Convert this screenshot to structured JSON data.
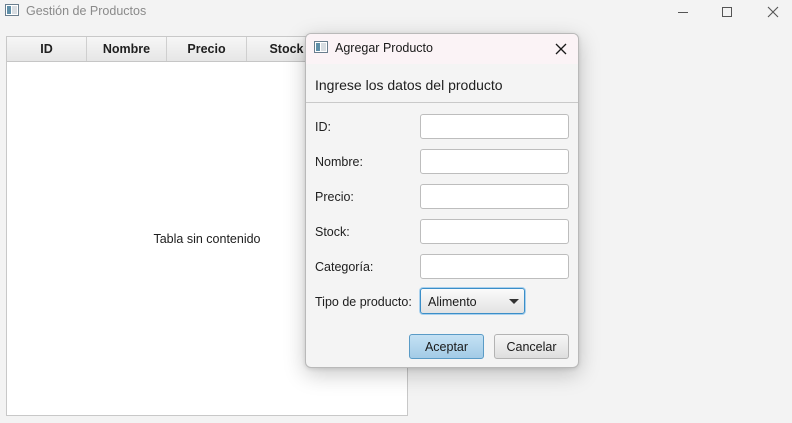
{
  "window": {
    "title": "Gestión de Productos"
  },
  "table": {
    "columns": [
      "ID",
      "Nombre",
      "Precio",
      "Stock"
    ],
    "placeholder": "Tabla sin contenido"
  },
  "dialog": {
    "title": "Agregar Producto",
    "header": "Ingrese los datos del producto",
    "fields": [
      {
        "label": "ID:",
        "value": ""
      },
      {
        "label": "Nombre:",
        "value": ""
      },
      {
        "label": "Precio:",
        "value": ""
      },
      {
        "label": "Stock:",
        "value": ""
      },
      {
        "label": "Categoría:",
        "value": ""
      }
    ],
    "type_label": "Tipo de producto:",
    "type_selected": "Alimento",
    "ok_label": "Aceptar",
    "cancel_label": "Cancelar"
  },
  "icons": [
    "app-icon",
    "minimize-icon",
    "maximize-icon",
    "close-icon",
    "chevron-down-icon"
  ],
  "colors": {
    "accent": "#3b8ec8",
    "ok_button": "#a3cbe6",
    "dialog_title_bg": "#fbf3f6"
  }
}
